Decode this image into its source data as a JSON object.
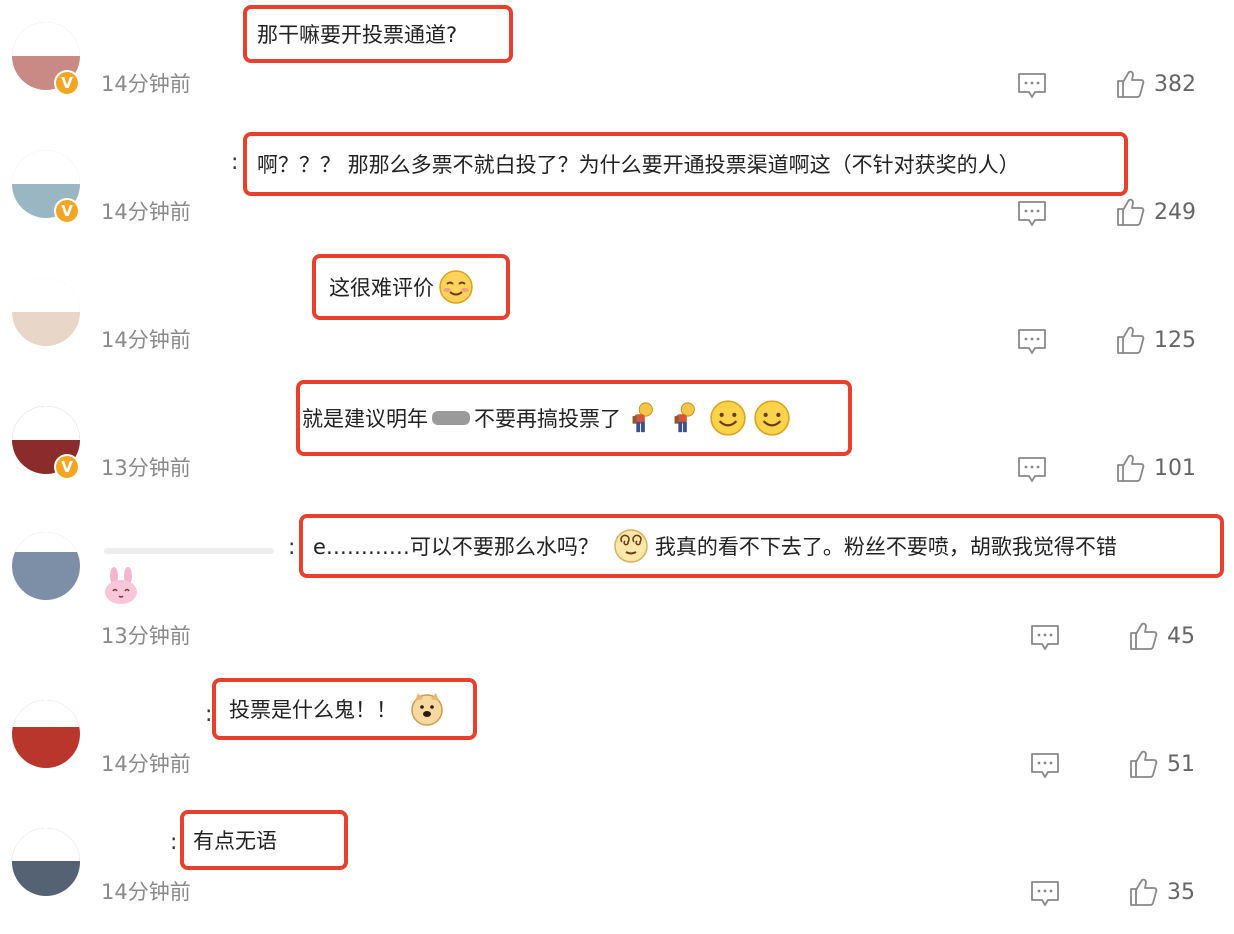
{
  "comments": [
    {
      "time": "14分钟前",
      "text": "那干嘛要开投票通道?",
      "likes": "382",
      "verified": true,
      "avatar_color": "#c98a85"
    },
    {
      "time": "14分钟前",
      "text": "啊？？？ 那那么多票不就白投了？为什么要开通投票渠道啊这（不针对获奖的人）",
      "likes": "249",
      "verified": true,
      "avatar_color": "#9bb6c3"
    },
    {
      "time": "14分钟前",
      "text": "这很难评价",
      "likes": "125",
      "verified": false,
      "avatar_color": "#e8d6c8"
    },
    {
      "time": "13分钟前",
      "text_a": "就是建议明年",
      "text_b": "不要再搞投票了",
      "likes": "101",
      "verified": true,
      "avatar_color": "#8b2b2b"
    },
    {
      "time": "13分钟前",
      "text": "e…………可以不要那么水吗？",
      "text2": "我真的看不下去了。粉丝不要喷，胡歌我觉得不错",
      "likes": "45",
      "verified": false,
      "avatar_color": "#7c8fa6"
    },
    {
      "time": "14分钟前",
      "text": "投票是什么鬼！！",
      "likes": "51",
      "verified": false,
      "avatar_color": "#b8362b"
    },
    {
      "time": "14分钟前",
      "text": "有点无语",
      "likes": "35",
      "verified": false,
      "avatar_color": "#556274"
    }
  ],
  "colors": {
    "highlight": "#e8402d",
    "badge": "#f2a623",
    "meta": "#8a8a8a"
  },
  "icons": {
    "reply": "comment-icon",
    "like": "thumbs-up-icon",
    "verified": "verified-badge-icon"
  },
  "badge_letter": "V",
  "colon": ":"
}
